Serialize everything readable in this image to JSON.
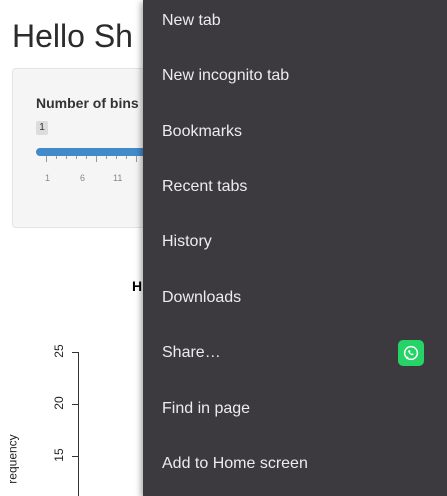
{
  "app": {
    "title": "Hello Sh",
    "sidebar_label": "Number of bins",
    "slider": {
      "min_badge": "1",
      "tick_labels": [
        "1",
        "6",
        "11"
      ]
    },
    "plot": {
      "title_fragment": "H",
      "y_axis_title": "requency",
      "y_ticks": [
        "25",
        "20",
        "15"
      ]
    }
  },
  "menu": {
    "items": [
      {
        "label": "New tab"
      },
      {
        "label": "New incognito tab"
      },
      {
        "label": "Bookmarks"
      },
      {
        "label": "Recent tabs"
      },
      {
        "label": "History"
      },
      {
        "label": "Downloads"
      },
      {
        "label": "Share…",
        "icon": "whatsapp-icon",
        "icon_color": "#25d366"
      },
      {
        "label": "Find in page"
      },
      {
        "label": "Add to Home screen"
      }
    ],
    "background_color": "#3c3a3f",
    "text_color": "#ececec"
  }
}
